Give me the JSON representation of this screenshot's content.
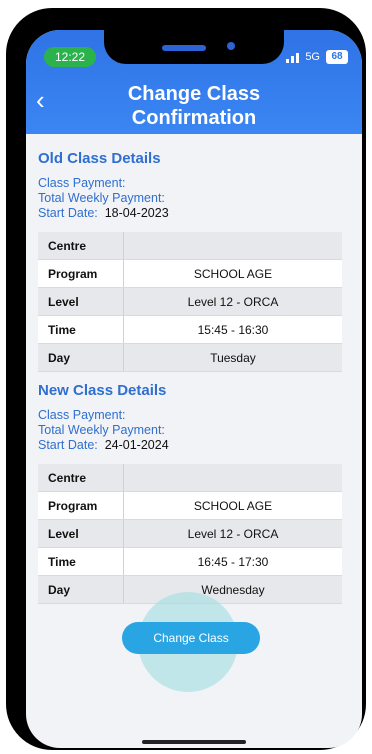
{
  "status_bar": {
    "time": "12:22",
    "network": "5G",
    "battery": "68"
  },
  "header": {
    "back_icon": "chevron-left-icon",
    "title_line1": "Change Class",
    "title_line2": "Confirmation"
  },
  "old_class": {
    "title": "Old Class Details",
    "class_payment_label": "Class Payment:",
    "total_weekly_payment_label": "Total Weekly Payment:",
    "start_date_label": "Start Date:",
    "start_date": "18-04-2023",
    "rows": [
      {
        "label": "Centre",
        "value": ""
      },
      {
        "label": "Program",
        "value": "SCHOOL AGE"
      },
      {
        "label": "Level",
        "value": "Level 12 - ORCA"
      },
      {
        "label": "Time",
        "value": "15:45 - 16:30"
      },
      {
        "label": "Day",
        "value": "Tuesday"
      }
    ]
  },
  "new_class": {
    "title": "New Class Details",
    "class_payment_label": "Class Payment:",
    "total_weekly_payment_label": "Total Weekly Payment:",
    "start_date_label": "Start Date:",
    "start_date": "24-01-2024",
    "rows": [
      {
        "label": "Centre",
        "value": ""
      },
      {
        "label": "Program",
        "value": "SCHOOL AGE"
      },
      {
        "label": "Level",
        "value": "Level 12 - ORCA"
      },
      {
        "label": "Time",
        "value": "16:45 - 17:30"
      },
      {
        "label": "Day",
        "value": "Wednesday"
      }
    ]
  },
  "actions": {
    "change_class_label": "Change Class"
  },
  "colors": {
    "header": "#2f73e6",
    "accent_text": "#2f6fcf",
    "button": "#2aa5e3"
  }
}
